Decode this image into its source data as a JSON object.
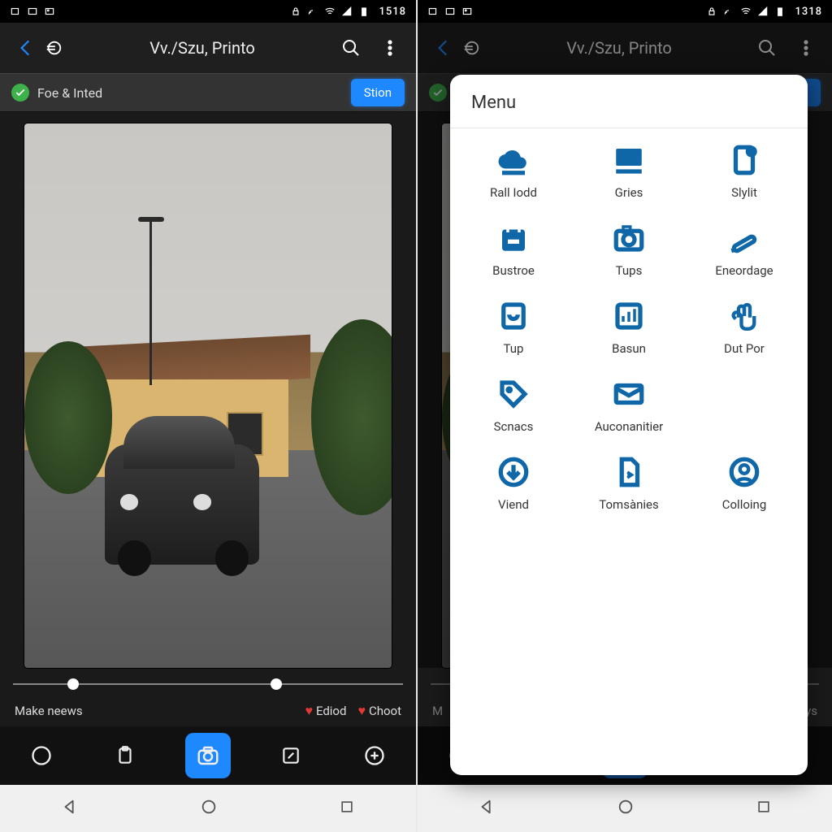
{
  "status": {
    "clock": "1518",
    "clock_r": "1318"
  },
  "appbar": {
    "title": "Vv./Szu, Printo"
  },
  "statusrow": {
    "label": "Foe & Inted",
    "button": "Stion"
  },
  "actions": {
    "left": "Make neews",
    "mid": "Ediod",
    "right": "Choot"
  },
  "actions_r": {
    "left": "M",
    "right": "oiys"
  },
  "menu": {
    "title": "Menu",
    "items": [
      {
        "label": "Rall Iodd",
        "icon": "cloud"
      },
      {
        "label": "Gries",
        "icon": "monitor"
      },
      {
        "label": "Slylit",
        "icon": "device"
      },
      {
        "label": "Bustroe",
        "icon": "calendar"
      },
      {
        "label": "Tups",
        "icon": "camera"
      },
      {
        "label": "Eneordage",
        "icon": "pencil"
      },
      {
        "label": "Tup",
        "icon": "box-u"
      },
      {
        "label": "Basun",
        "icon": "chart"
      },
      {
        "label": "Dut Por",
        "icon": "hand"
      },
      {
        "label": "Scnacs",
        "icon": "tag"
      },
      {
        "label": "Auconanitier",
        "icon": "mail"
      },
      {
        "label": "",
        "icon": ""
      },
      {
        "label": "Viend",
        "icon": "download"
      },
      {
        "label": "Tomsànies",
        "icon": "file"
      },
      {
        "label": "Colloing",
        "icon": "person"
      }
    ]
  }
}
